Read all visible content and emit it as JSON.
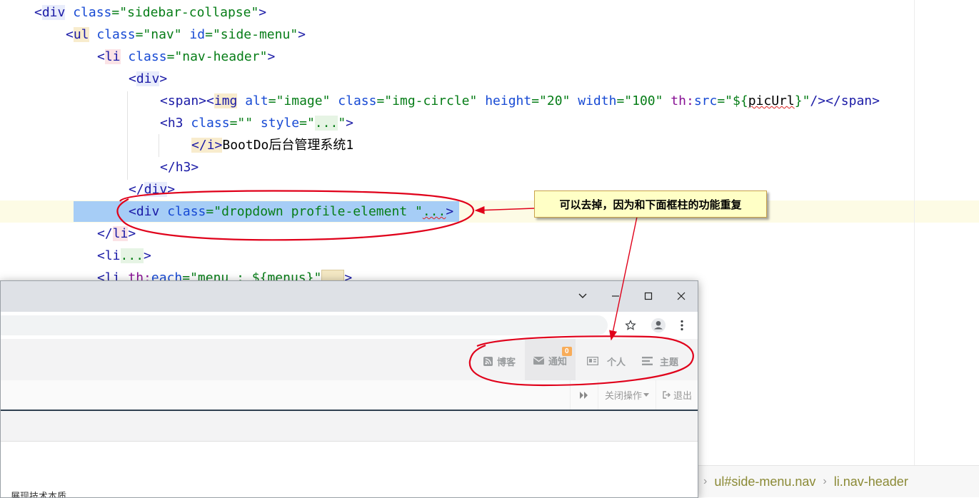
{
  "editor": {
    "lines": [
      {
        "indent": 1,
        "parts": [
          {
            "t": "<",
            "c": "t-tag"
          },
          {
            "t": "div",
            "c": "t-tag tag-bg-blue"
          },
          {
            "t": " class",
            "c": "t-attr"
          },
          {
            "t": "=\"sidebar-collapse\"",
            "c": "t-val"
          },
          {
            "t": ">",
            "c": "t-tag"
          }
        ]
      },
      {
        "indent": 2,
        "parts": [
          {
            "t": "<",
            "c": "t-tag"
          },
          {
            "t": "ul",
            "c": "t-tag tag-bg-yel"
          },
          {
            "t": " class",
            "c": "t-attr"
          },
          {
            "t": "=\"nav\"",
            "c": "t-val"
          },
          {
            "t": " id",
            "c": "t-attr"
          },
          {
            "t": "=\"side-menu\"",
            "c": "t-val"
          },
          {
            "t": ">",
            "c": "t-tag"
          }
        ]
      },
      {
        "indent": 3,
        "parts": [
          {
            "t": "<",
            "c": "t-tag"
          },
          {
            "t": "li",
            "c": "t-tag tag-bg-pink"
          },
          {
            "t": " class",
            "c": "t-attr"
          },
          {
            "t": "=\"nav-header\"",
            "c": "t-val"
          },
          {
            "t": ">",
            "c": "t-tag"
          }
        ]
      },
      {
        "indent": 4,
        "parts": [
          {
            "t": "<",
            "c": "t-tag"
          },
          {
            "t": "div",
            "c": "t-tag tag-bg-blue"
          },
          {
            "t": ">",
            "c": "t-tag"
          }
        ]
      },
      {
        "indent": 5,
        "parts": [
          {
            "t": "<span><",
            "c": "t-tag"
          },
          {
            "t": "img",
            "c": "t-tag tag-bg-yel"
          },
          {
            "t": " alt",
            "c": "t-attr"
          },
          {
            "t": "=\"image\"",
            "c": "t-val"
          },
          {
            "t": " class",
            "c": "t-attr"
          },
          {
            "t": "=\"img-circle\"",
            "c": "t-val"
          },
          {
            "t": " height",
            "c": "t-attr"
          },
          {
            "t": "=\"20\"",
            "c": "t-val"
          },
          {
            "t": " width",
            "c": "t-attr"
          },
          {
            "t": "=\"100\"",
            "c": "t-val"
          },
          {
            "t": " th:",
            "c": "t-ns"
          },
          {
            "t": "src",
            "c": "t-attr"
          },
          {
            "t": "=\"${",
            "c": "t-val"
          },
          {
            "t": "picUrl",
            "c": "t-txt wavy"
          },
          {
            "t": "}\"",
            "c": "t-val"
          },
          {
            "t": "/></span>",
            "c": "t-tag"
          }
        ]
      },
      {
        "indent": 5,
        "parts": [
          {
            "t": "<",
            "c": "t-tag"
          },
          {
            "t": "h3",
            "c": "t-tag"
          },
          {
            "t": " class",
            "c": "t-attr"
          },
          {
            "t": "=\"\"",
            "c": "t-val"
          },
          {
            "t": " style",
            "c": "t-attr"
          },
          {
            "t": "=\"",
            "c": "t-val"
          },
          {
            "t": "...",
            "c": "t-val tag-bg-green"
          },
          {
            "t": "\"",
            "c": "t-val"
          },
          {
            "t": ">",
            "c": "t-tag"
          }
        ]
      },
      {
        "indent": 6,
        "parts": [
          {
            "t": "</",
            "c": "t-tag tag-bg-yel"
          },
          {
            "t": "i",
            "c": "t-tag tag-bg-yel"
          },
          {
            "t": ">",
            "c": "t-tag tag-bg-yel"
          },
          {
            "t": "BootDo后台管理系统1",
            "c": "t-txt"
          }
        ]
      },
      {
        "indent": 5,
        "parts": [
          {
            "t": "</",
            "c": "t-tag"
          },
          {
            "t": "h3",
            "c": "t-tag"
          },
          {
            "t": ">",
            "c": "t-tag"
          }
        ]
      },
      {
        "indent": 4,
        "parts": [
          {
            "t": "</",
            "c": "t-tag"
          },
          {
            "t": "div",
            "c": "t-tag tag-bg-blue"
          },
          {
            "t": ">",
            "c": "t-tag"
          }
        ]
      },
      {
        "indent": 4,
        "parts": [
          {
            "t": "<",
            "c": "t-tag"
          },
          {
            "t": "div",
            "c": "t-tag"
          },
          {
            "t": " class",
            "c": "t-attr"
          },
          {
            "t": "=\"dropdown profile-element \"",
            "c": "t-val"
          },
          {
            "t": "...",
            "c": "t-val wavy"
          },
          {
            "t": ">",
            "c": "t-tag"
          }
        ]
      },
      {
        "indent": 3,
        "parts": [
          {
            "t": "</",
            "c": "t-tag"
          },
          {
            "t": "li",
            "c": "t-tag tag-bg-pink"
          },
          {
            "t": ">",
            "c": "t-tag"
          }
        ]
      },
      {
        "indent": 3,
        "parts": [
          {
            "t": "<",
            "c": "t-tag"
          },
          {
            "t": "li",
            "c": "t-tag"
          },
          {
            "t": "...",
            "c": "t-val tag-bg-green"
          },
          {
            "t": ">",
            "c": "t-tag"
          }
        ]
      },
      {
        "indent": 3,
        "parts": [
          {
            "t": "<",
            "c": "t-tag"
          },
          {
            "t": "li",
            "c": "t-tag"
          },
          {
            "t": " th:",
            "c": "t-ns"
          },
          {
            "t": "each",
            "c": "t-attr"
          },
          {
            "t": "=\"menu : ${menus}\"",
            "c": "t-val"
          },
          {
            "t": "FOLD",
            "c": "fold"
          },
          {
            "t": ">",
            "c": "t-tag"
          }
        ]
      }
    ],
    "breadcrumb": [
      "ul#side-menu.nav",
      "li.nav-header"
    ]
  },
  "browser": {
    "window_controls": {
      "menu": "⌄",
      "minimize": "—",
      "maximize": "☐",
      "close": "✕"
    },
    "toolbar_icons": [
      "star-icon",
      "profile-icon",
      "more-icon"
    ],
    "nav": [
      {
        "label": "博客",
        "icon": "rss-icon"
      },
      {
        "label": "通知",
        "icon": "envelope-icon",
        "badge": "0"
      },
      {
        "label": "个人",
        "icon": "id-card-icon"
      },
      {
        "label": "主题",
        "icon": "list-icon"
      }
    ],
    "tabbar": {
      "forward": "▶▶",
      "close_ops": "关闭操作",
      "logout": "退出"
    },
    "body_text": "展现技术本质"
  },
  "annotation": {
    "callout_text": "可以去掉，因为和下面框柱的功能重复",
    "color": "#e0001a"
  }
}
